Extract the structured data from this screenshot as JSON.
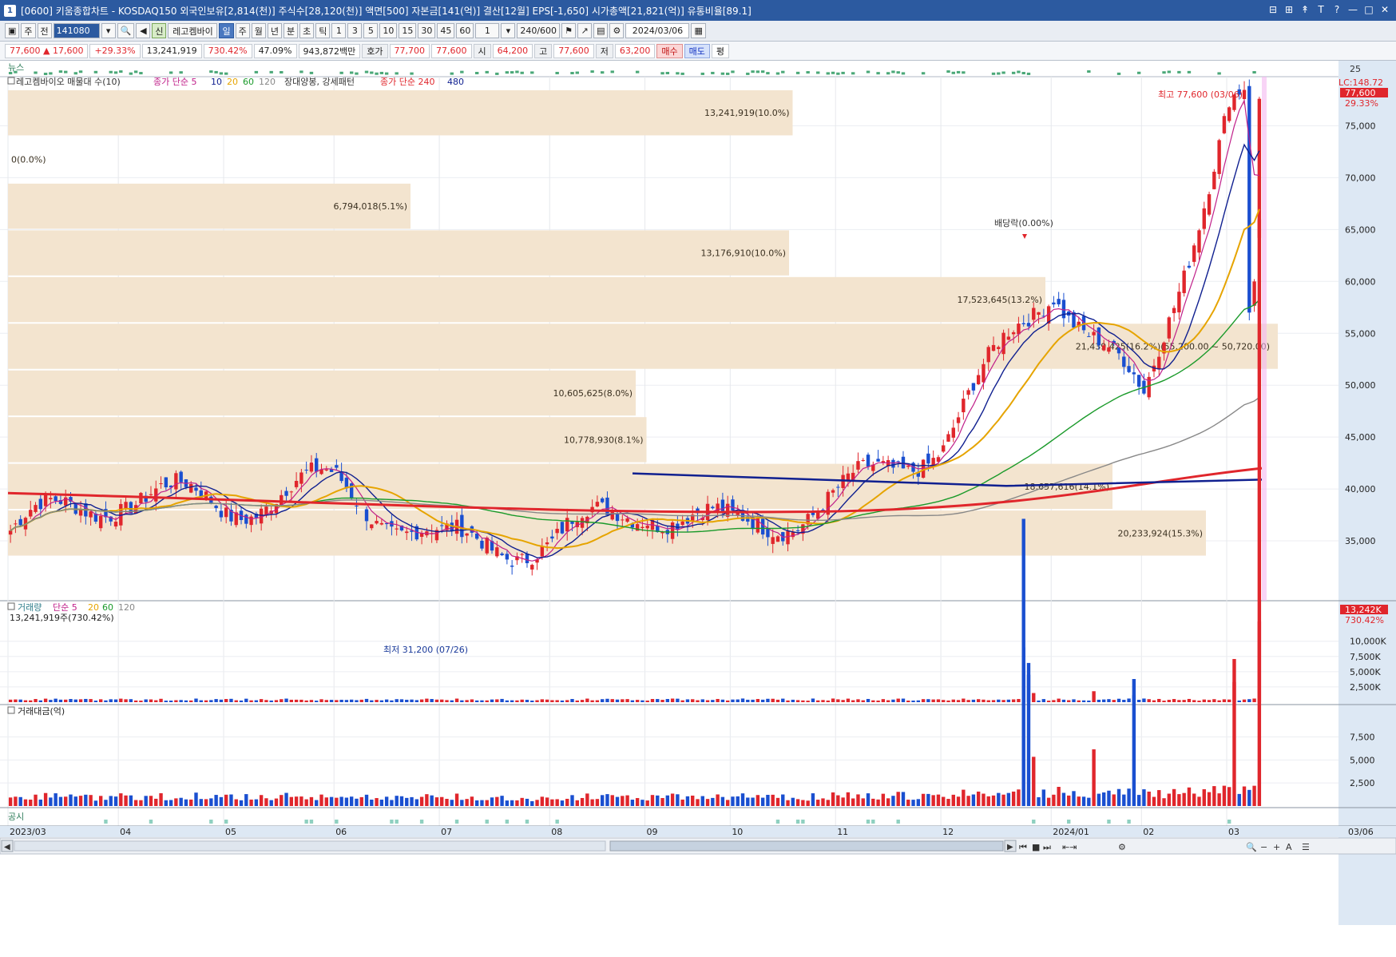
{
  "window": {
    "number": "1",
    "title": "[0600] 키움종합차트 - KOSDAQ150 외국인보유[2,814(천)] 주식수[28,120(천)] 액면[500] 자본금[141(억)] 결산[12월] EPS[-1,650] 시가총액[21,821(억)] 유통비율[89.1]"
  },
  "toolbar": {
    "type_select": "주",
    "prev_label": "전",
    "code": "141080",
    "new_label": "신",
    "stock_name": "레고켐바이",
    "periods": [
      "일",
      "주",
      "월",
      "년",
      "분",
      "초",
      "틱"
    ],
    "active_period": "일",
    "intervals": [
      "1",
      "3",
      "5",
      "10",
      "15",
      "30",
      "45",
      "60"
    ],
    "count_value": "1",
    "range": "240/600",
    "date": "2024/03/06"
  },
  "pricebar": {
    "price": "77,600",
    "change": "▲ 17,600",
    "change_pct": "+29.33%",
    "volume": "13,241,919",
    "volume_pct": "730.42%",
    "turnover": "47.09%",
    "amount": "943,872백만",
    "quote_label": "호가",
    "ask": "77,700",
    "bid": "77,600",
    "open_label": "시",
    "open": "64,200",
    "high_label": "고",
    "high": "77,600",
    "low_label": "저",
    "low": "63,200",
    "buy_label": "매수",
    "sell_label": "매도",
    "eval_label": "평"
  },
  "news_label": "뉴스",
  "news_scale": "25",
  "disclosure_label": "공시",
  "price_legend": {
    "item1": "레고켐바이오 매물대 수(10)",
    "item2": "종가 단순 5",
    "ma10": "10",
    "ma20": "20",
    "ma60": "60",
    "ma120": "120",
    "item3": "장대양봉, 강세패턴",
    "item4": "종가 단순 240",
    "ma480": "480"
  },
  "price_axis": {
    "ticks": [
      "75,000",
      "70,000",
      "65,000",
      "60,000",
      "55,000",
      "50,000",
      "45,000",
      "40,000",
      "35,000"
    ],
    "lc_label": "LC:148.72",
    "current": "77,600",
    "current_pct": "29.33%"
  },
  "annotations": {
    "high": "최고 77,600 (03/06)",
    "low": "최저 31,200 (07/26)",
    "dividend": "배당락(0.00%)"
  },
  "volume_profile": [
    {
      "label": "13,241,919(10.0%)",
      "width": 0.655
    },
    {
      "label": "0(0.0%)",
      "width": 0.0
    },
    {
      "label": "6,794,018(5.1%)",
      "width": 0.336
    },
    {
      "label": "13,176,910(10.0%)",
      "width": 0.652
    },
    {
      "label": "17,523,645(13.2%)",
      "width": 0.866
    },
    {
      "label": "21,439,425(16.2%)(55,200.00 ~ 50,720.00)",
      "width": 1.06
    },
    {
      "label": "10,605,625(8.0%)",
      "width": 0.524
    },
    {
      "label": "10,778,930(8.1%)",
      "width": 0.533
    },
    {
      "label": "18,657,616(14.1%)",
      "width": 0.922
    },
    {
      "label": "20,233,924(15.3%)",
      "width": 1.0
    }
  ],
  "volume_panel": {
    "legend_title": "거래량",
    "legend_ma": "단순 5",
    "ma20": "20",
    "ma60": "60",
    "ma120": "120",
    "value_text": "13,241,919주(730.42%)",
    "ticks": [
      "10,000K",
      "7,500K",
      "5,000K",
      "2,500K"
    ],
    "current": "13,242K",
    "current_pct": "730.42%"
  },
  "amount_panel": {
    "legend_title": "거래대금(억)",
    "ticks": [
      "7,500",
      "5,000",
      "2,500"
    ]
  },
  "x_axis": {
    "labels": [
      "2023/03",
      "04",
      "05",
      "06",
      "07",
      "08",
      "09",
      "10",
      "11",
      "12",
      "2024/01",
      "02",
      "03"
    ],
    "right_label": "03/06"
  },
  "colors": {
    "up": "#e0262c",
    "down": "#1a4fd0",
    "ma5": "#c0208a",
    "ma10": "#102090",
    "ma20": "#e6a400",
    "ma60": "#1a9a2a",
    "ma120": "#888888",
    "ma240": "#e0262c",
    "ma480": "#102090",
    "profile": "#f3e4cf"
  },
  "chart_data": {
    "type": "candlestick",
    "title": "레고켐바이오",
    "x_range": [
      "2023/03",
      "2024/03/06"
    ],
    "y_range": [
      31200,
      77600
    ],
    "month_x_labels": [
      "2023/03",
      "04",
      "05",
      "06",
      "07",
      "08",
      "09",
      "10",
      "11",
      "12",
      "2024/01",
      "02",
      "03"
    ],
    "monthly_close": [
      36000,
      39500,
      38500,
      40500,
      34500,
      35000,
      38500,
      36000,
      39000,
      45000,
      60000,
      48000,
      77600
    ],
    "last_close": 77600,
    "high": {
      "value": 77600,
      "date": "03/06"
    },
    "low": {
      "value": 31200,
      "date": "07/26"
    },
    "last_volume": 13241919
  }
}
